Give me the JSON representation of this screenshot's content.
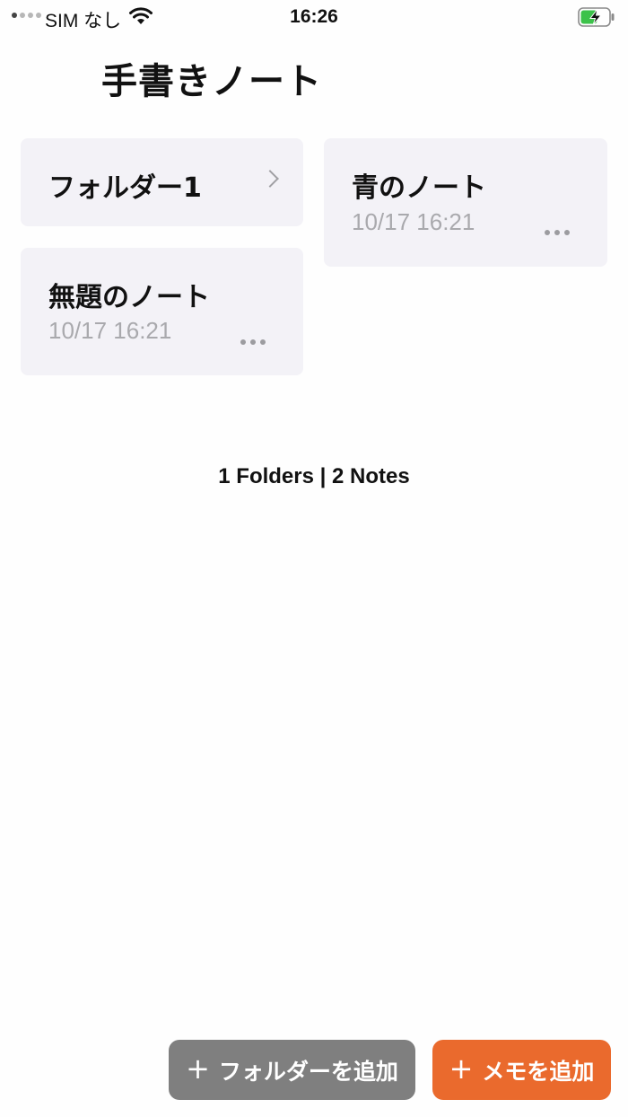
{
  "status_bar": {
    "carrier": "SIM なし",
    "time": "16:26"
  },
  "title": "手書きノート",
  "items": [
    {
      "name": "フォルダー1",
      "type": "folder"
    },
    {
      "name": "青のノート",
      "type": "note",
      "date": "10/17 16:21"
    },
    {
      "name": "無題のノート",
      "type": "note",
      "date": "10/17 16:21"
    }
  ],
  "summary": "1 Folders | 2 Notes",
  "actions": {
    "plus": "+",
    "add_folder": "フォルダーを追加",
    "add_memo": "メモを追加"
  },
  "colors": {
    "card_bg": "#f3f2f7",
    "add_folder_bg": "#7f7f7f",
    "add_memo_bg": "#ea6a2d",
    "date_gray": "#a9a9ad",
    "battery_green": "#3cc24a"
  }
}
